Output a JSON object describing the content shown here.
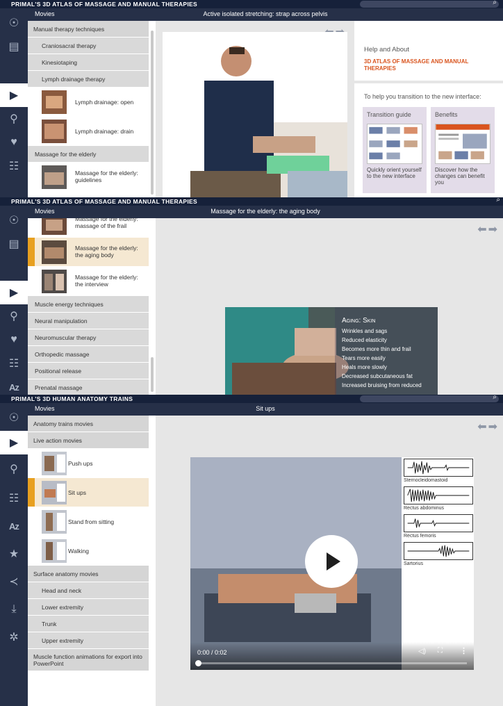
{
  "panels": [
    {
      "app_title": "PRIMAL'S 3D ATLAS OF MASSAGE AND MANUAL THERAPIES",
      "tab": "Movies",
      "content_title": "Active isolated stretching: strap across pelvis",
      "list": [
        {
          "type": "cat",
          "label": "Manual therapy techniques"
        },
        {
          "type": "sub",
          "label": "Craniosacral therapy"
        },
        {
          "type": "sub",
          "label": "Kinesiotaping"
        },
        {
          "type": "sub",
          "label": "Lymph drainage therapy"
        },
        {
          "type": "vid",
          "label": "Lymph drainage: open"
        },
        {
          "type": "vid",
          "label": "Lymph drainage: drain"
        },
        {
          "type": "sub",
          "label": "Massage for the elderly"
        },
        {
          "type": "vid",
          "label": "Massage for the elderly: guidelines"
        }
      ],
      "help": {
        "title": "Help and About",
        "subtitle": "3D ATLAS OF MASSAGE AND MANUAL THERAPIES",
        "intro": "To help you transition to the new interface:",
        "cards": [
          {
            "title": "Transition guide",
            "desc": "Quickly orient yourself to the new interface"
          },
          {
            "title": "Benefits",
            "desc": "Discover how the changes can benefit you"
          }
        ]
      }
    },
    {
      "app_title": "PRIMAL'S 3D ATLAS OF MASSAGE AND MANUAL THERAPIES",
      "tab": "Movies",
      "content_title": "Massage for the elderly: the aging body",
      "list": [
        {
          "type": "vid",
          "label": "Massage for the elderly: massage of the frail"
        },
        {
          "type": "vid",
          "label": "Massage for the elderly: the aging body",
          "selected": true
        },
        {
          "type": "vid",
          "label": "Massage for the elderly: the interview"
        },
        {
          "type": "sub",
          "label": "Muscle energy techniques"
        },
        {
          "type": "sub",
          "label": "Neural manipulation"
        },
        {
          "type": "sub",
          "label": "Neuromuscular therapy"
        },
        {
          "type": "sub",
          "label": "Orthopedic massage"
        },
        {
          "type": "sub",
          "label": "Positional release"
        },
        {
          "type": "sub",
          "label": "Prenatal massage"
        }
      ],
      "overlay": {
        "title": "Aging: Skin",
        "items": [
          "Wrinkles and sags",
          "Reduced elasticity",
          "Becomes more thin and frail",
          "Tears more easily",
          "Heals more slowly",
          "Decreased subcutaneous fat",
          "Increased bruising from reduced"
        ]
      }
    },
    {
      "app_title": "PRIMAL'S 3D HUMAN ANATOMY TRAINS",
      "tab": "Movies",
      "content_title": "Sit ups",
      "list": [
        {
          "type": "cat",
          "label": "Anatomy trains movies"
        },
        {
          "type": "cat",
          "label": "Live action movies"
        },
        {
          "type": "vid",
          "label": "Push ups"
        },
        {
          "type": "vid",
          "label": "Sit ups",
          "selected": true
        },
        {
          "type": "vid",
          "label": "Stand from sitting"
        },
        {
          "type": "vid",
          "label": "Walking"
        },
        {
          "type": "cat",
          "label": "Surface anatomy movies"
        },
        {
          "type": "sub",
          "label": "Head and neck"
        },
        {
          "type": "sub",
          "label": "Lower extremity"
        },
        {
          "type": "sub",
          "label": "Trunk"
        },
        {
          "type": "sub",
          "label": "Upper extremity"
        },
        {
          "type": "cat",
          "label": "Muscle function animations for export into PowerPoint"
        }
      ],
      "emg_labels": [
        "Sternocleidomastoid",
        "Rectus abdominus",
        "Rectus femoris",
        "Sartorius"
      ],
      "video_time": "0:00 / 0:02",
      "video_progress": 0
    }
  ],
  "icons": {
    "search": "search-icon",
    "arrows": "back-forward-arrows-icon",
    "play": "play-icon"
  },
  "colors": {
    "app_bar": "#16213a",
    "rail": "#263048",
    "selected_marker": "#e8a020",
    "selected_row": "#f5e8d2",
    "help_subtitle": "#d9541e",
    "card_bg": "#e3dce9"
  }
}
